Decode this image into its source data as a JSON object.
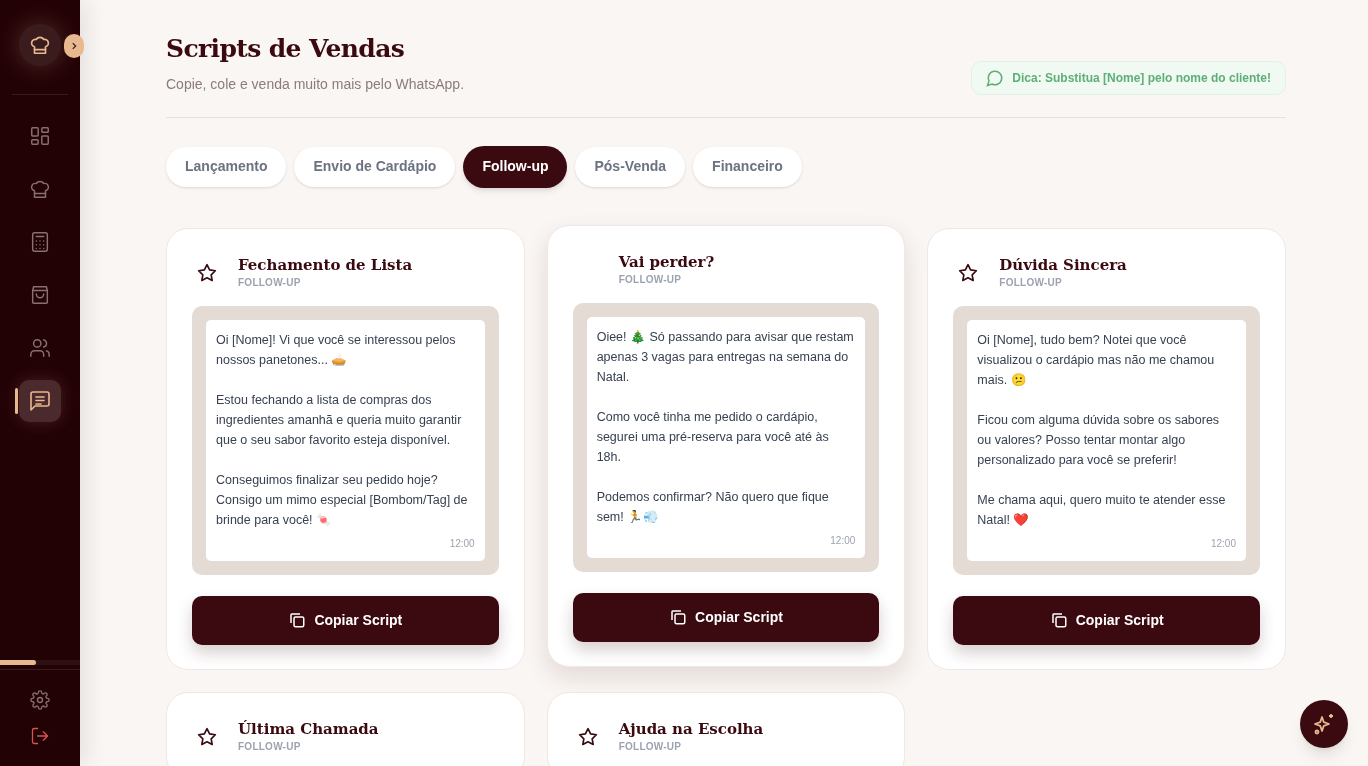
{
  "sidebar": {
    "items": [
      {
        "kind": "grid",
        "selected": false
      },
      {
        "kind": "chef",
        "selected": false
      },
      {
        "kind": "calculator",
        "selected": false
      },
      {
        "kind": "bag",
        "selected": false
      },
      {
        "kind": "users",
        "selected": false
      },
      {
        "kind": "messages",
        "selected": true
      }
    ],
    "footer": [
      {
        "kind": "settings"
      },
      {
        "kind": "logout"
      }
    ],
    "progress": {
      "level": 0.45
    }
  },
  "header": {
    "title": "Scripts de Vendas",
    "subtitle": "Copie, cole e venda muito mais pelo WhatsApp.",
    "tip": "Dica: Substitua [Nome] pelo nome do cliente!"
  },
  "tabs": [
    {
      "label": "Lançamento",
      "selected": false
    },
    {
      "label": "Envio de Cardápio",
      "selected": false
    },
    {
      "label": "Follow-up",
      "selected": true
    },
    {
      "label": "Pós-Venda",
      "selected": false
    },
    {
      "label": "Financeiro",
      "selected": false
    }
  ],
  "cards": [
    {
      "title": "Fechamento de Lista",
      "category": "FOLLOW-UP",
      "hovered": false,
      "message": "Oi [Nome]! Vi que você se interessou pelos nossos panetones... 🥧\n\nEstou fechando a lista de compras dos ingredientes amanhã e queria muito garantir que o seu sabor favorito esteja disponível.\n\nConseguimos finalizar seu pedido hoje? Consigo um mimo especial [Bombom/Tag] de brinde para você! 🍬",
      "time": "12:00",
      "button": "Copiar Script"
    },
    {
      "title": "Vai perder?",
      "category": "FOLLOW-UP",
      "hovered": true,
      "message": "Oiee! 🎄 Só passando para avisar que restam apenas 3 vagas para entregas na semana do Natal.\n\nComo você tinha me pedido o cardápio, segurei uma pré-reserva para você até às 18h.\n\nPodemos confirmar? Não quero que fique sem! 🏃💨",
      "time": "12:00",
      "button": "Copiar Script"
    },
    {
      "title": "Dúvida Sincera",
      "category": "FOLLOW-UP",
      "hovered": false,
      "message": "Oi [Nome], tudo bem? Notei que você visualizou o cardápio mas não me chamou mais. 😕\n\nFicou com alguma dúvida sobre os sabores ou valores? Posso tentar montar algo personalizado para você se preferir!\n\nMe chama aqui, quero muito te atender esse Natal! ❤️",
      "time": "12:00",
      "button": "Copiar Script"
    },
    {
      "title": "Última Chamada",
      "category": "FOLLOW-UP",
      "hovered": false
    },
    {
      "title": "Ajuda na Escolha",
      "category": "FOLLOW-UP",
      "hovered": false
    }
  ]
}
